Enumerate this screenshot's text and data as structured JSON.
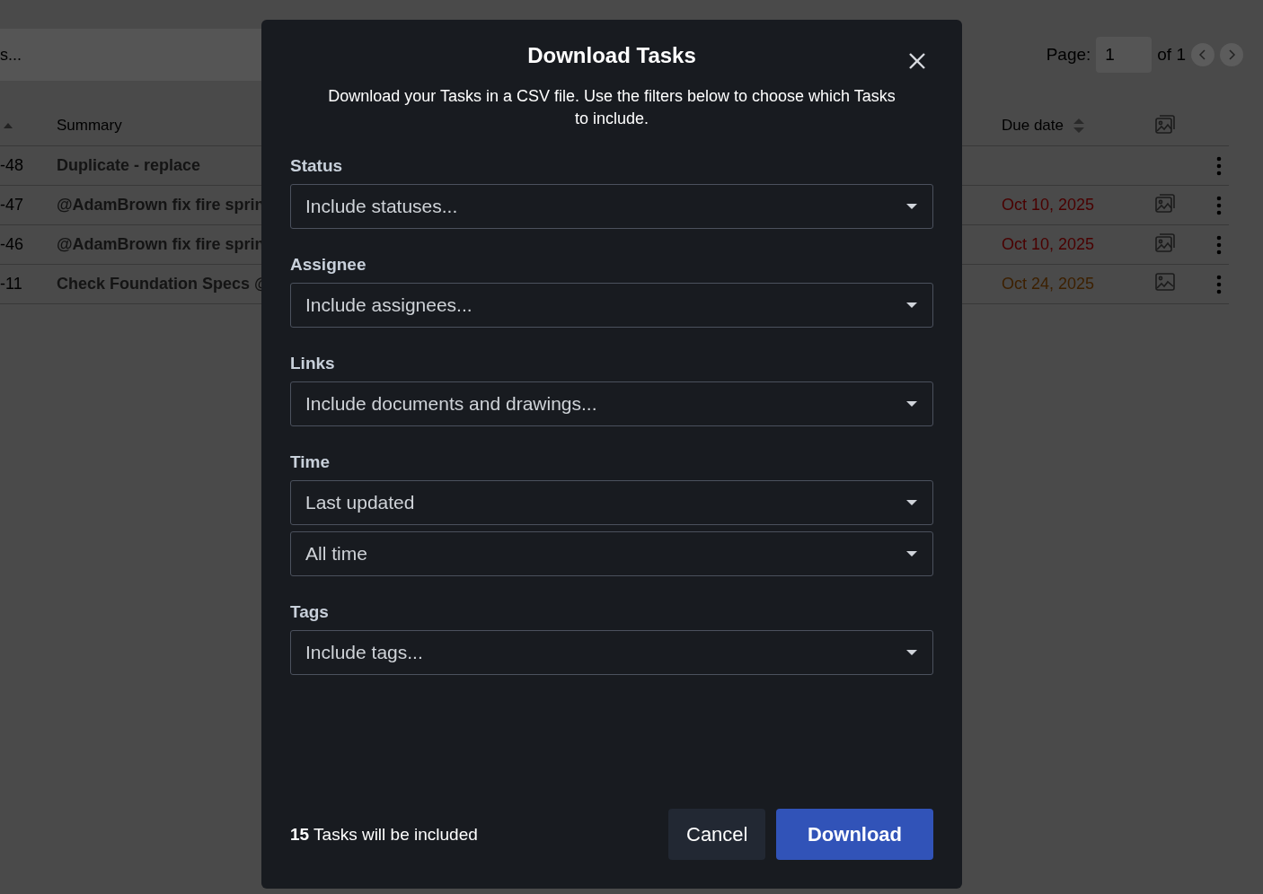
{
  "toolbar": {
    "search_text": "s...",
    "page_label": "Page:",
    "page_value": "1",
    "page_total": "of 1"
  },
  "table": {
    "columns": [
      "Summary",
      "Due date"
    ],
    "rows": [
      {
        "id": "-48",
        "summary": "Duplicate - replace",
        "due": "",
        "kind": "none"
      },
      {
        "id": "-47",
        "summary": "@AdamBrown fix fire sprin",
        "due": "Oct 10, 2025",
        "color": "#4a0000",
        "kind": "stack"
      },
      {
        "id": "-46",
        "summary": "@AdamBrown fix fire sprin",
        "due": "Oct 10, 2025",
        "color": "#4a0000",
        "kind": "stack"
      },
      {
        "id": "-11",
        "summary": "Check Foundation Specs @",
        "due": "Oct 24, 2025",
        "color": "#3d2000",
        "kind": "single"
      }
    ]
  },
  "dialog": {
    "title": "Download Tasks",
    "description": "Download your Tasks in a CSV file. Use the filters below to choose which Tasks to include.",
    "filters": [
      {
        "label": "Status",
        "selects": [
          "Include statuses..."
        ]
      },
      {
        "label": "Assignee",
        "selects": [
          "Include assignees..."
        ]
      },
      {
        "label": "Links",
        "selects": [
          "Include documents and drawings..."
        ]
      },
      {
        "label": "Time",
        "selects": [
          "Last updated",
          "All time"
        ]
      },
      {
        "label": "Tags",
        "selects": [
          "Include tags..."
        ]
      }
    ],
    "summary": "**15** Tasks will be included",
    "buttons": [
      {
        "label": "Cancel",
        "kind": "secondary"
      },
      {
        "label": "Download",
        "kind": "primary"
      }
    ]
  }
}
